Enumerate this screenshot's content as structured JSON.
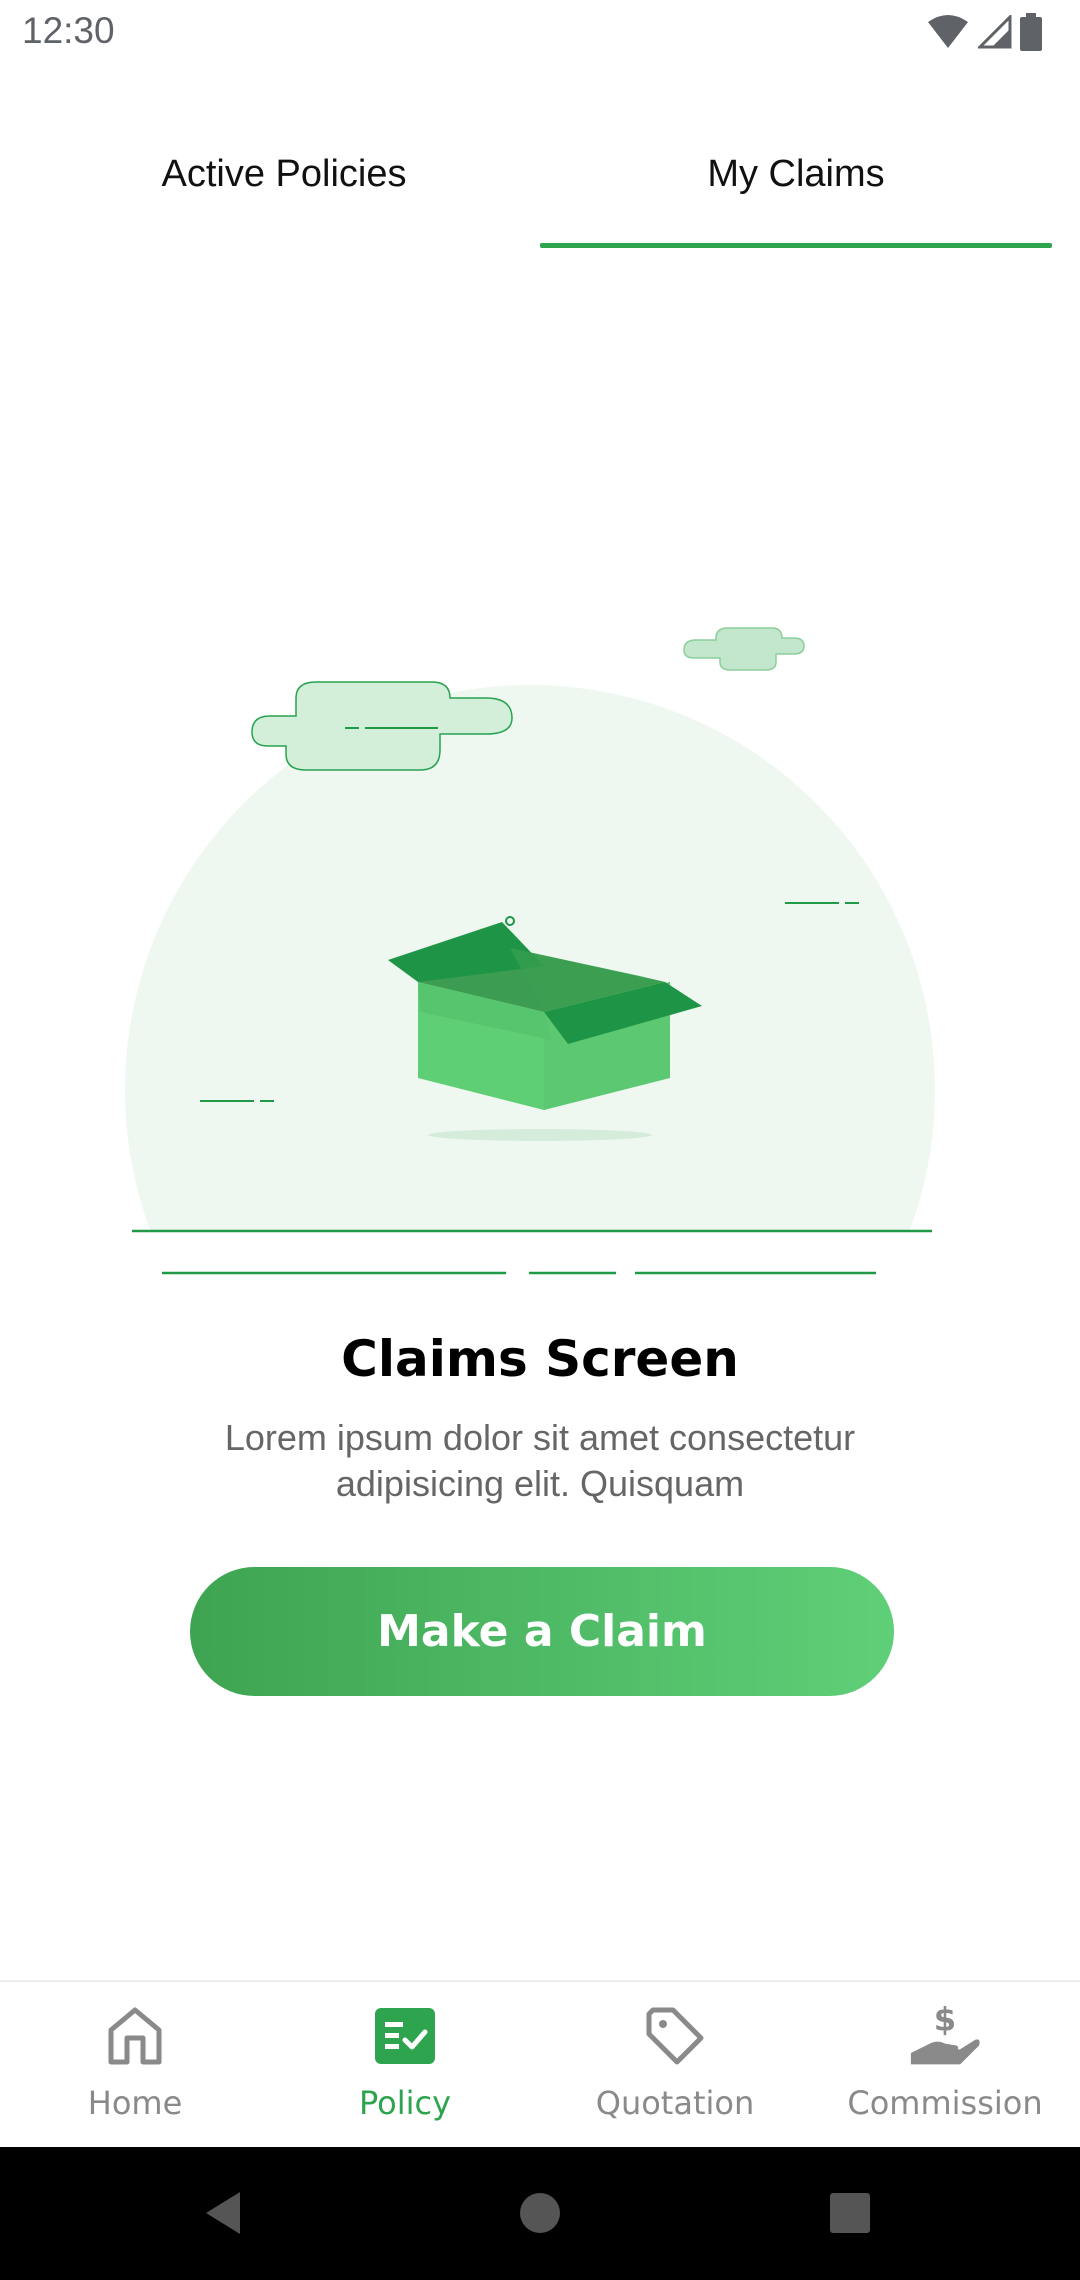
{
  "status_bar": {
    "time": "12:30",
    "icons": [
      "wifi-icon",
      "signal-icon",
      "battery-icon"
    ]
  },
  "tabs": [
    {
      "label": "Active Policies",
      "active": false
    },
    {
      "label": "My Claims",
      "active": true
    }
  ],
  "main": {
    "title": "Claims Screen",
    "description": "Lorem ipsum dolor sit amet consectetur adipisicing elit. Quisquam",
    "button_label": "Make a Claim"
  },
  "bottom_nav": {
    "items": [
      {
        "label": "Home",
        "icon": "home-icon",
        "active": false
      },
      {
        "label": "Policy",
        "icon": "policy-icon",
        "active": true
      },
      {
        "label": "Quotation",
        "icon": "tag-icon",
        "active": false
      },
      {
        "label": "Commission",
        "icon": "commission-icon",
        "active": false
      }
    ]
  },
  "system_nav": {
    "buttons": [
      "back-icon",
      "home-circle-icon",
      "recents-icon"
    ]
  },
  "colors": {
    "accent": "#2ea44f",
    "button_start": "#3ea452",
    "button_end": "#5fcf78",
    "illustration_bg": "#eef8f0",
    "inactive_nav": "#8a8a8a"
  }
}
